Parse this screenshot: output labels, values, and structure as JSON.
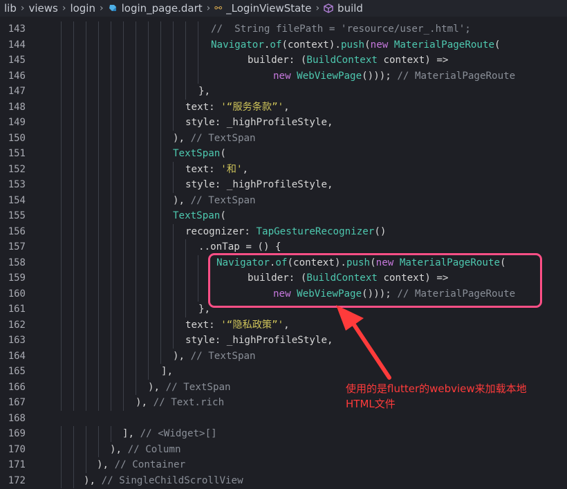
{
  "breadcrumb": {
    "items": [
      "lib",
      "views",
      "login",
      "login_page.dart",
      "_LoginViewState",
      "build"
    ]
  },
  "lines": [
    {
      "n": "143",
      "tokens": [
        {
          "t": "//  String filePath = 'resource/user_.html';",
          "c": "t-c"
        }
      ]
    },
    {
      "n": "144",
      "tokens": [
        {
          "t": "Navigator",
          "c": "t-cls"
        },
        {
          "t": ".",
          "c": "t-p"
        },
        {
          "t": "of",
          "c": "t-cls"
        },
        {
          "t": "(context).",
          "c": "t-p"
        },
        {
          "t": "push",
          "c": "t-cls"
        },
        {
          "t": "(",
          "c": "t-p"
        },
        {
          "t": "new ",
          "c": "t-kw"
        },
        {
          "t": "MaterialPageRoute",
          "c": "t-cls"
        },
        {
          "t": "(",
          "c": "t-p"
        }
      ]
    },
    {
      "n": "145",
      "tokens": [
        {
          "t": "builder: (",
          "c": "t-p"
        },
        {
          "t": "BuildContext",
          "c": "t-cls"
        },
        {
          "t": " context) =>",
          "c": "t-p"
        }
      ]
    },
    {
      "n": "146",
      "tokens": [
        {
          "t": "new ",
          "c": "t-kw"
        },
        {
          "t": "WebViewPage",
          "c": "t-cls"
        },
        {
          "t": "())); ",
          "c": "t-p"
        },
        {
          "t": "// MaterialPageRoute",
          "c": "t-c"
        }
      ]
    },
    {
      "n": "147",
      "tokens": [
        {
          "t": "},",
          "c": "t-p"
        }
      ]
    },
    {
      "n": "148",
      "tokens": [
        {
          "t": "text: ",
          "c": "t-p"
        },
        {
          "t": "'“服务条款”'",
          "c": "t-s"
        },
        {
          "t": ",",
          "c": "t-p"
        }
      ]
    },
    {
      "n": "149",
      "tokens": [
        {
          "t": "style: _highProfileStyle,",
          "c": "t-p"
        }
      ]
    },
    {
      "n": "150",
      "tokens": [
        {
          "t": "), ",
          "c": "t-p"
        },
        {
          "t": "// TextSpan",
          "c": "t-c"
        }
      ]
    },
    {
      "n": "151",
      "tokens": [
        {
          "t": "TextSpan",
          "c": "t-cls"
        },
        {
          "t": "(",
          "c": "t-p"
        }
      ]
    },
    {
      "n": "152",
      "tokens": [
        {
          "t": "text: ",
          "c": "t-p"
        },
        {
          "t": "'和'",
          "c": "t-s"
        },
        {
          "t": ",",
          "c": "t-p"
        }
      ]
    },
    {
      "n": "153",
      "tokens": [
        {
          "t": "style: _highProfileStyle,",
          "c": "t-p"
        }
      ]
    },
    {
      "n": "154",
      "tokens": [
        {
          "t": "), ",
          "c": "t-p"
        },
        {
          "t": "// TextSpan",
          "c": "t-c"
        }
      ]
    },
    {
      "n": "155",
      "tokens": [
        {
          "t": "TextSpan",
          "c": "t-cls"
        },
        {
          "t": "(",
          "c": "t-p"
        }
      ]
    },
    {
      "n": "156",
      "tokens": [
        {
          "t": "recognizer: ",
          "c": "t-p"
        },
        {
          "t": "TapGestureRecognizer",
          "c": "t-cls"
        },
        {
          "t": "()",
          "c": "t-p"
        }
      ]
    },
    {
      "n": "157",
      "tokens": [
        {
          "t": "..onTap = () {",
          "c": "t-p"
        }
      ]
    },
    {
      "n": "158",
      "tokens": [
        {
          "t": "Navigator",
          "c": "t-cls"
        },
        {
          "t": ".",
          "c": "t-p"
        },
        {
          "t": "of",
          "c": "t-cls"
        },
        {
          "t": "(context).",
          "c": "t-p"
        },
        {
          "t": "push",
          "c": "t-cls"
        },
        {
          "t": "(",
          "c": "t-p"
        },
        {
          "t": "new ",
          "c": "t-kw"
        },
        {
          "t": "MaterialPageRoute",
          "c": "t-cls"
        },
        {
          "t": "(",
          "c": "t-p"
        }
      ]
    },
    {
      "n": "159",
      "tokens": [
        {
          "t": "builder: (",
          "c": "t-p"
        },
        {
          "t": "BuildContext",
          "c": "t-cls"
        },
        {
          "t": " context) =>",
          "c": "t-p"
        }
      ]
    },
    {
      "n": "160",
      "tokens": [
        {
          "t": "new ",
          "c": "t-kw"
        },
        {
          "t": "WebViewPage",
          "c": "t-cls"
        },
        {
          "t": "())); ",
          "c": "t-p"
        },
        {
          "t": "// MaterialPageRoute",
          "c": "t-c"
        }
      ]
    },
    {
      "n": "161",
      "tokens": [
        {
          "t": "},",
          "c": "t-p"
        }
      ]
    },
    {
      "n": "162",
      "tokens": [
        {
          "t": "text: ",
          "c": "t-p"
        },
        {
          "t": "'“隐私政策”'",
          "c": "t-s"
        },
        {
          "t": ",",
          "c": "t-p"
        }
      ]
    },
    {
      "n": "163",
      "tokens": [
        {
          "t": "style: _highProfileStyle,",
          "c": "t-p"
        }
      ]
    },
    {
      "n": "164",
      "tokens": [
        {
          "t": "), ",
          "c": "t-p"
        },
        {
          "t": "// TextSpan",
          "c": "t-c"
        }
      ]
    },
    {
      "n": "165",
      "tokens": [
        {
          "t": "],",
          "c": "t-p"
        }
      ]
    },
    {
      "n": "166",
      "tokens": [
        {
          "t": "), ",
          "c": "t-p"
        },
        {
          "t": "// TextSpan",
          "c": "t-c"
        }
      ]
    },
    {
      "n": "167",
      "tokens": [
        {
          "t": "), ",
          "c": "t-p"
        },
        {
          "t": "// Text.rich",
          "c": "t-c"
        }
      ]
    },
    {
      "n": "168",
      "tokens": []
    },
    {
      "n": "169",
      "tokens": [
        {
          "t": "], ",
          "c": "t-p"
        },
        {
          "t": "// <Widget>[]",
          "c": "t-c"
        }
      ]
    },
    {
      "n": "170",
      "tokens": [
        {
          "t": "), ",
          "c": "t-p"
        },
        {
          "t": "// Column",
          "c": "t-c"
        }
      ]
    },
    {
      "n": "171",
      "tokens": [
        {
          "t": "), ",
          "c": "t-p"
        },
        {
          "t": "// Container",
          "c": "t-c"
        }
      ]
    },
    {
      "n": "172",
      "tokens": [
        {
          "t": "), ",
          "c": "t-p"
        },
        {
          "t": "// SingleChildScrollView",
          "c": "t-c"
        }
      ]
    }
  ],
  "annotation": {
    "line1": "使用的是flutter的webview来加载本地",
    "line2": "HTML文件"
  },
  "colors": {
    "highlight": "#ff4f86",
    "annotation": "#ff3b3b"
  }
}
